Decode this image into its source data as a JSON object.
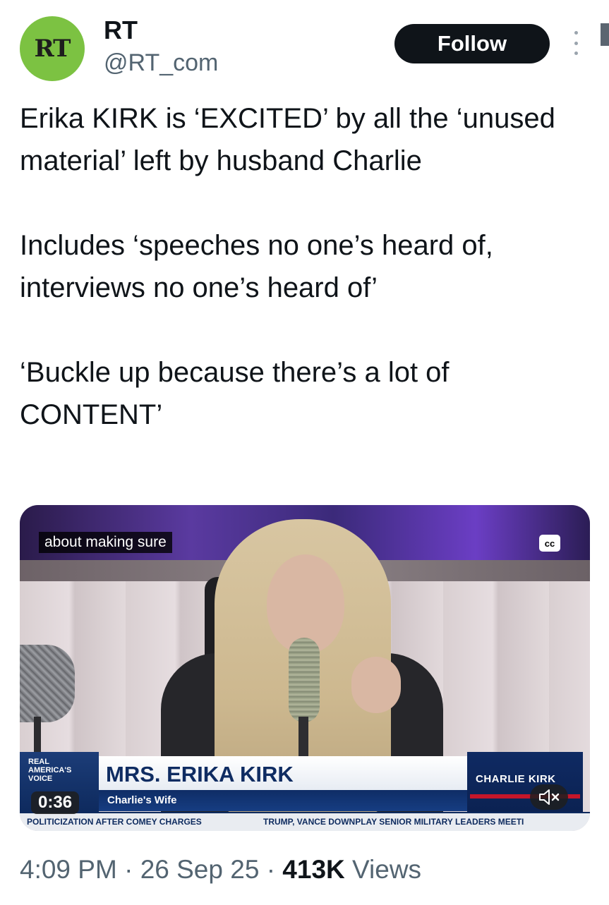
{
  "account": {
    "avatar_text": "RT",
    "name": "RT",
    "handle": "@RT_com"
  },
  "follow_label": "Follow",
  "tweet": {
    "paragraphs": [
      "Erika KIRK is ‘EXCITED’ by all the ‘unused material’ left by husband Charlie",
      "Includes ‘speeches no one’s heard of, interviews no one’s heard of’",
      "‘Buckle up because there’s a lot of CONTENT’"
    ]
  },
  "video": {
    "caption": "about making sure",
    "cc_label": "cc",
    "time": "0:36",
    "lower_third": {
      "logo_lines": [
        "REAL",
        "AMERICA'S",
        "VOICE"
      ],
      "name": "MRS. ERIKA KIRK",
      "subtitle": "Charlie's Wife",
      "show": "CHARLIE KIRK",
      "ticker_left": "POLITICIZATION AFTER COMEY CHARGES",
      "ticker_right": "TRUMP, VANCE DOWNPLAY SENIOR MILITARY LEADERS MEETI"
    },
    "icons": {
      "mute": "speaker-muted-icon",
      "captions": "closed-captions-icon",
      "more": "more-options-icon"
    }
  },
  "meta": {
    "time": "4:09 PM",
    "separator": "·",
    "date": "26 Sep 25",
    "views_count": "413K",
    "views_label": "Views"
  },
  "colors": {
    "avatar_bg": "#7cc242",
    "follow_bg": "#0f1419",
    "secondary_text": "#536471"
  }
}
